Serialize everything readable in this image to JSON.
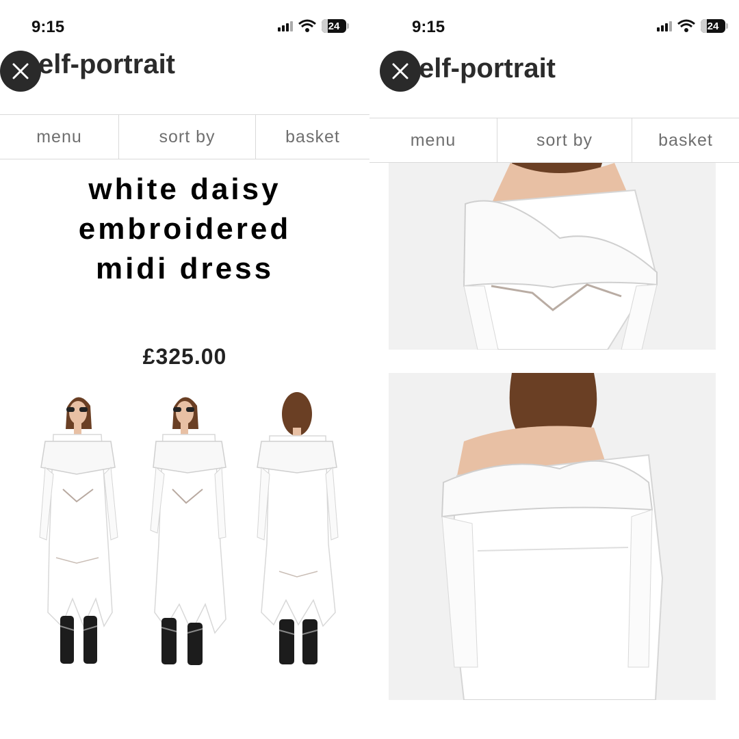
{
  "status_bar": {
    "time": "9:15",
    "battery": "24",
    "battery_fraction": 0.24
  },
  "brand": {
    "name": "elf-portrait"
  },
  "nav": {
    "items": [
      "menu",
      "sort by",
      "basket"
    ]
  },
  "product": {
    "title_lines": [
      "white daisy",
      "embroidered",
      "midi dress"
    ],
    "price": "£325.00",
    "thumbnails": [
      "model-front-sunglasses",
      "model-front-pose",
      "model-back"
    ],
    "detail_images": [
      "neckline-front-closeup",
      "shoulder-back-closeup"
    ]
  },
  "colors": {
    "accent": "#2a2a2a",
    "nav_text": "#6f6f6f",
    "divider": "#d9d9d9",
    "photo_background": "#f1f1f1",
    "dress": "#ffffff",
    "hair": "#6a3f24",
    "skin": "#e8c0a4",
    "boot": "#1c1c1c"
  }
}
